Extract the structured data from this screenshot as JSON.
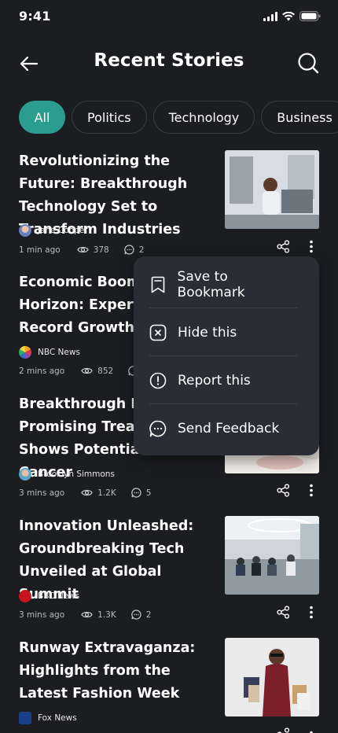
{
  "status": {
    "time": "9:41"
  },
  "header": {
    "title": "Recent Stories"
  },
  "chips": [
    "All",
    "Politics",
    "Technology",
    "Business"
  ],
  "stories": [
    {
      "title": "Revolutionizing the Future: Breakthrough Technology Set to Transform Industries",
      "source": "Jane Cooper",
      "time": "1 min ago",
      "views": "378",
      "comments": "2"
    },
    {
      "title": "Economic Boom on the Horizon: Experts Predict Record Growth in",
      "source": "NBC News",
      "time": "2 mins ago",
      "views": "852",
      "comments": ""
    },
    {
      "title": "Breakthrough Discovery: Promising Treatment Shows Potential in Cancer",
      "source": "Brooklyn Simmons",
      "time": "3 mins ago",
      "views": "1.2K",
      "comments": "5"
    },
    {
      "title": "Innovation Unleashed: Groundbreaking Tech Unveiled at Global Summit",
      "source": "BBC News",
      "time": "3 mins ago",
      "views": "1.3K",
      "comments": "2"
    },
    {
      "title": "Runway Extravaganza: Highlights from the Latest Fashion Week",
      "source": "Fox News",
      "time": "",
      "views": "",
      "comments": ""
    }
  ],
  "menu": {
    "bookmark": "Save to Bookmark",
    "hide": "Hide this",
    "report": "Report this",
    "feedback": "Send Feedback"
  },
  "colors": {
    "accent": "#2a9d8f",
    "background": "#1c1d21",
    "menu": "#2b2d35"
  }
}
